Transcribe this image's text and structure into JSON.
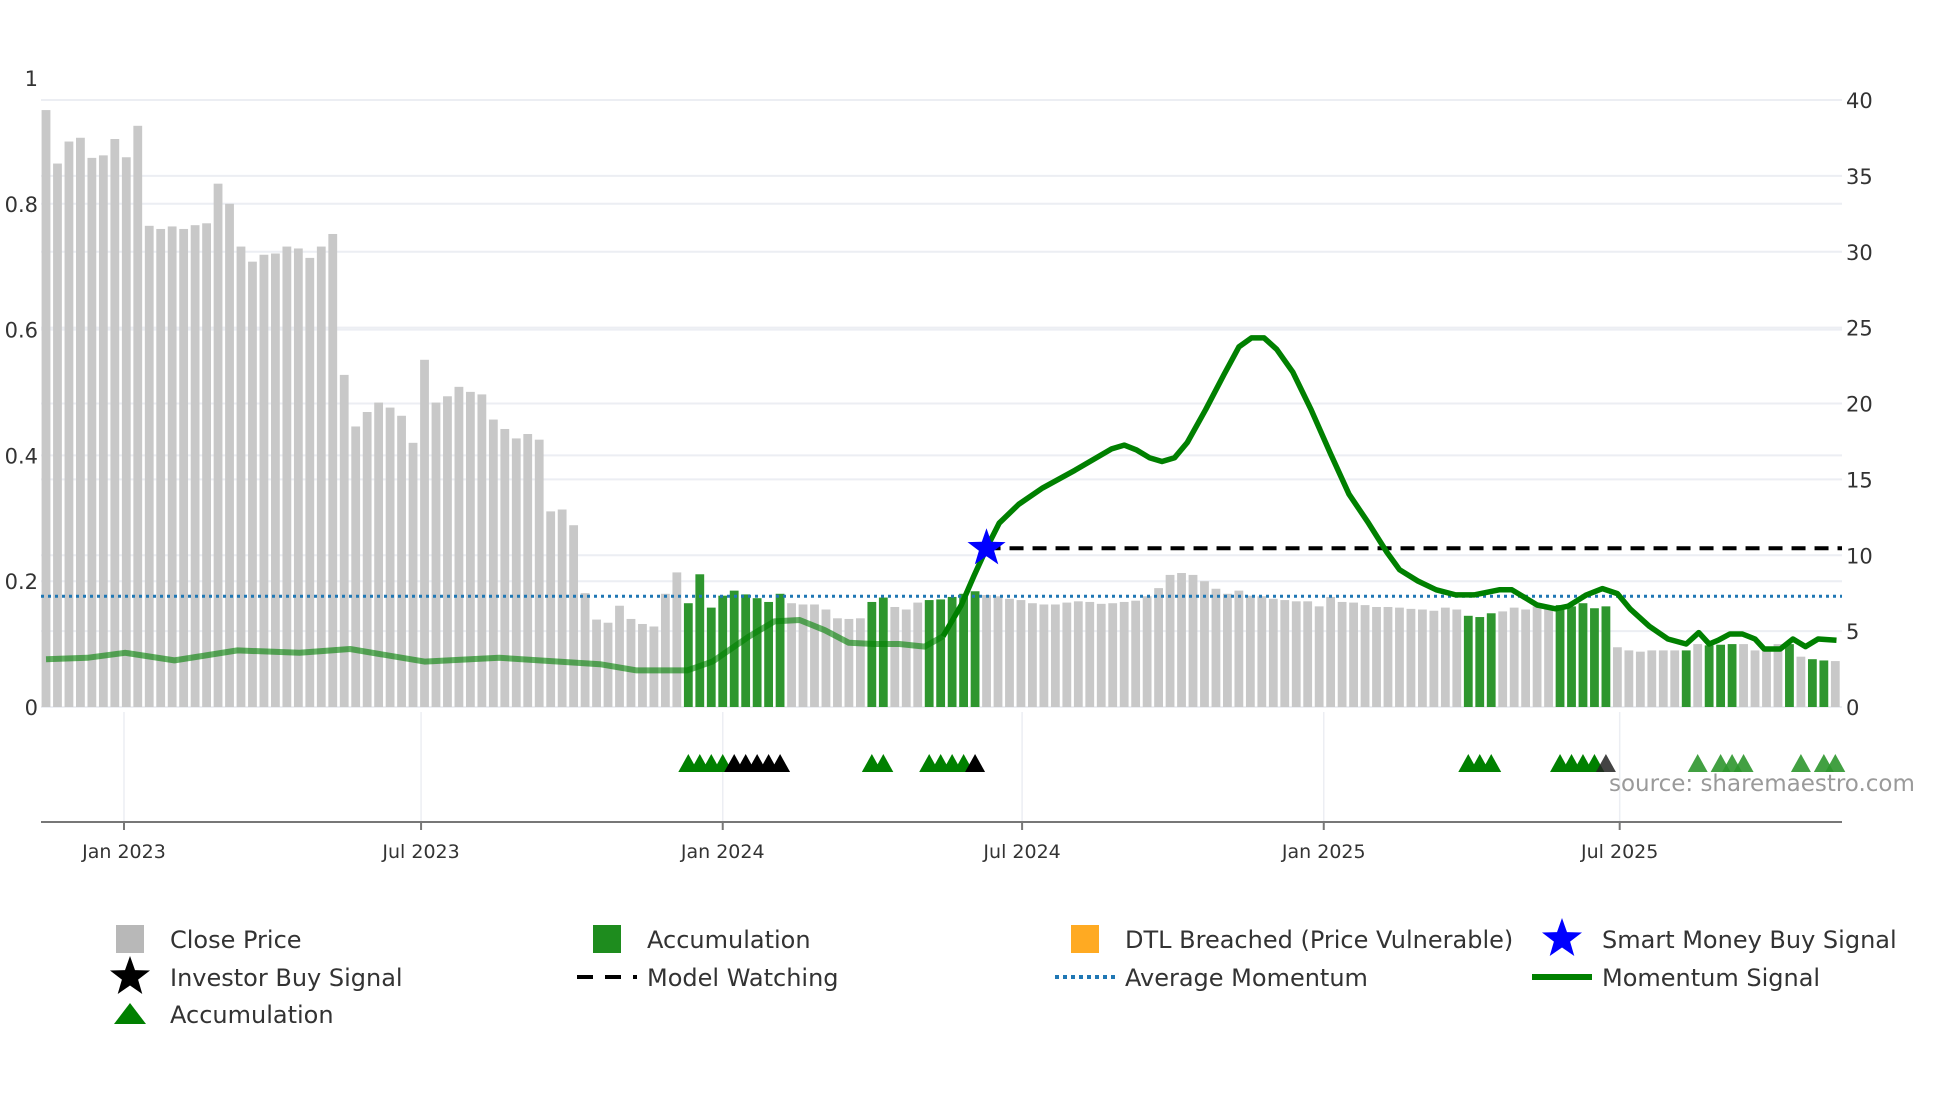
{
  "chart_data": {
    "type": "bar",
    "title": "",
    "x_unit": "week index",
    "left_axis": {
      "ylim": [
        0,
        1
      ],
      "ticks": [
        0,
        0.2,
        0.4,
        0.6,
        0.8,
        1
      ],
      "tick_labels": [
        "0",
        "0.2",
        "0.4",
        "0.6",
        "0.8",
        "1"
      ]
    },
    "right_axis": {
      "ylim": [
        0,
        40
      ],
      "ticks": [
        0,
        5,
        10,
        15,
        20,
        25,
        30,
        35,
        40
      ],
      "tick_labels": [
        "0",
        "5",
        "10",
        "15",
        "20",
        "25",
        "30",
        "35",
        "40"
      ]
    },
    "x_ticks": [
      {
        "label": "Jan 2023",
        "week": 6.8
      },
      {
        "label": "Jul 2023",
        "week": 32.7
      },
      {
        "label": "Jan 2024",
        "week": 59.0
      },
      {
        "label": "Jul 2024",
        "week": 85.1
      },
      {
        "label": "Jan 2025",
        "week": 111.4
      },
      {
        "label": "Jul 2025",
        "week": 137.2
      }
    ],
    "close_price": [
      0.949,
      0.864,
      0.899,
      0.905,
      0.873,
      0.877,
      0.903,
      0.874,
      0.924,
      0.765,
      0.76,
      0.764,
      0.76,
      0.766,
      0.769,
      0.832,
      0.8,
      0.732,
      0.708,
      0.719,
      0.721,
      0.732,
      0.729,
      0.714,
      0.732,
      0.752,
      0.528,
      0.446,
      0.469,
      0.484,
      0.476,
      0.463,
      0.42,
      0.552,
      0.484,
      0.494,
      0.509,
      0.501,
      0.497,
      0.457,
      0.442,
      0.427,
      0.434,
      0.425,
      0.311,
      0.314,
      0.289,
      0.181,
      0.139,
      0.134,
      0.161,
      0.14,
      0.132,
      0.128,
      0.18,
      0.214,
      0.165,
      0.211,
      0.158,
      0.177,
      0.185,
      0.179,
      0.173,
      0.167,
      0.18,
      0.165,
      0.163,
      0.163,
      0.155,
      0.141,
      0.14,
      0.141,
      0.167,
      0.174,
      0.159,
      0.155,
      0.166,
      0.17,
      0.171,
      0.175,
      0.18,
      0.184,
      0.178,
      0.176,
      0.172,
      0.17,
      0.165,
      0.163,
      0.163,
      0.166,
      0.168,
      0.167,
      0.164,
      0.165,
      0.167,
      0.169,
      0.176,
      0.189,
      0.21,
      0.213,
      0.21,
      0.2,
      0.188,
      0.18,
      0.185,
      0.177,
      0.176,
      0.172,
      0.17,
      0.168,
      0.168,
      0.16,
      0.175,
      0.167,
      0.166,
      0.162,
      0.159,
      0.159,
      0.158,
      0.156,
      0.155,
      0.153,
      0.158,
      0.155,
      0.145,
      0.143,
      0.149,
      0.152,
      0.158,
      0.155,
      0.16,
      0.158,
      0.162,
      0.16,
      0.165,
      0.157,
      0.16,
      0.095,
      0.09,
      0.088,
      0.09,
      0.09,
      0.09,
      0.09,
      0.1,
      0.098,
      0.099,
      0.1,
      0.1,
      0.09,
      0.09,
      0.1,
      0.1,
      0.08,
      0.076,
      0.074,
      0.073
    ],
    "accumulation_weeks": [
      56,
      57,
      58,
      59,
      60,
      61,
      62,
      63,
      64,
      72,
      73,
      77,
      78,
      79,
      80,
      81,
      124,
      125,
      126,
      132,
      133,
      134,
      135,
      136,
      143,
      145,
      146,
      147,
      152,
      154,
      155
    ],
    "momentum_signal": {
      "week": [
        0,
        3.6,
        6.9,
        11.2,
        16.7,
        22.1,
        26.5,
        33,
        39.5,
        48.3,
        51.5,
        55.9,
        58.1,
        61.3,
        63.5,
        65.7,
        67.9,
        70,
        72.2,
        74.4,
        76.6,
        78.2,
        79.8,
        80.9,
        82,
        83.1,
        84.8,
        86.9,
        89.7,
        92.9,
        94,
        95.1,
        96.2,
        97.3,
        98.4,
        99.5,
        101.1,
        102.7,
        104,
        105.1,
        106.2,
        107.3,
        108.7,
        110.3,
        112,
        113.6,
        115.3,
        116.9,
        118,
        119.6,
        121.2,
        122.9,
        124.5,
        126.7,
        127.8,
        128.9,
        130,
        131.6,
        132.7,
        134.3,
        135.7,
        137,
        138.1,
        139.8,
        141.4,
        143,
        144.1,
        145,
        145.8,
        146.8,
        147.9,
        149,
        149.8,
        151.2,
        152.3,
        153.4,
        154.5,
        156.1
      ],
      "value": [
        3.15,
        3.24,
        3.57,
        3.07,
        3.73,
        3.57,
        3.82,
        2.99,
        3.24,
        2.82,
        2.41,
        2.41,
        2.99,
        4.65,
        5.64,
        5.73,
        5.06,
        4.23,
        4.15,
        4.15,
        3.98,
        4.65,
        6.72,
        8.63,
        10.46,
        12.12,
        13.36,
        14.44,
        15.6,
        17.01,
        17.26,
        16.93,
        16.43,
        16.18,
        16.43,
        17.43,
        19.59,
        21.91,
        23.73,
        24.32,
        24.32,
        23.57,
        22.07,
        19.59,
        16.68,
        14.02,
        12.12,
        10.21,
        9.05,
        8.3,
        7.72,
        7.39,
        7.39,
        7.72,
        7.72,
        7.22,
        6.72,
        6.47,
        6.64,
        7.39,
        7.8,
        7.47,
        6.47,
        5.31,
        4.48,
        4.15,
        4.9,
        4.15,
        4.4,
        4.81,
        4.81,
        4.48,
        3.82,
        3.82,
        4.48,
        3.98,
        4.48,
        4.4
      ],
      "faded_until_week": 77
    },
    "average_momentum": 7.3,
    "model_watching": {
      "from_week": 82,
      "value": 10.46
    },
    "smart_money_buy_signal": {
      "week": 82,
      "value": 10.46
    },
    "accumulation_markers": [
      56,
      57,
      58,
      59,
      72,
      73,
      77,
      78,
      79,
      80,
      124,
      125,
      126,
      132,
      133,
      134,
      135
    ],
    "accumulation_markers_light": [
      144,
      146,
      147,
      148,
      153,
      155,
      156
    ],
    "investor_buy_markers": [
      60,
      61,
      62,
      63,
      64,
      81
    ],
    "investor_buy_markers_light": [
      136
    ],
    "colors": {
      "close_price": "#c8c8c8",
      "accumulation": "#2e962e",
      "dtl": "#ffaa22",
      "smart_money": "#0000ff",
      "investor": "#000000",
      "model_watching": "#000000",
      "average_momentum": "#1f77b4",
      "momentum": "#008000",
      "triangle": "#008000"
    },
    "legend": [
      {
        "label": "Close Price",
        "marker": "gray-square"
      },
      {
        "label": "Accumulation",
        "marker": "green-square"
      },
      {
        "label": "DTL Breached (Price Vulnerable)",
        "marker": "orange-square"
      },
      {
        "label": "Smart Money Buy Signal",
        "marker": "blue-star"
      },
      {
        "label": "Investor Buy Signal",
        "marker": "black-star"
      },
      {
        "label": "Model Watching",
        "marker": "dashed-line"
      },
      {
        "label": "Average Momentum",
        "marker": "dotted-line"
      },
      {
        "label": "Momentum Signal",
        "marker": "green-line"
      },
      {
        "label": "Accumulation",
        "marker": "green-triangle"
      }
    ],
    "legend_placement": "bottom",
    "source": "source: sharemaestro.com"
  }
}
